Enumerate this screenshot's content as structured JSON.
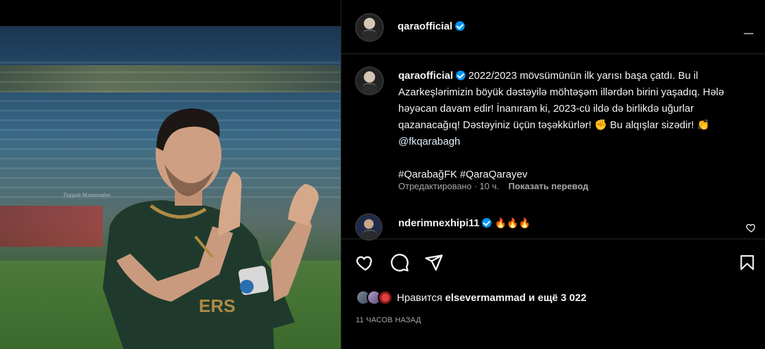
{
  "post": {
    "username": "qaraofficial",
    "caption": "2022/2023 mövsümünün ilk yarısı başa çatdı. Bu il Azarkeşlərimizin böyük dəstəyilə möhtəşəm illərdən birini yaşadıq. Hələ həyəcan davam edir! İnanıram ki, 2023-cü ildə də birlikdə uğurlar qazanacağıq! Dəstəyiniz üçün təşəkkürlər! ✊ Bu alqışlar sizədir! 👏",
    "caption_mention": "@fkqarabagh",
    "hashtags": "#QarabağFK #QaraQarayev",
    "edited_label": "Отредактировано",
    "edited_sep": " · ",
    "edited_time": "10 ч.",
    "translate_label": "Показать перевод",
    "photo_watermark": "Təyyub Məmmədov"
  },
  "comment": {
    "username": "nderimnexhipi11",
    "text": "🔥🔥🔥"
  },
  "actions": {
    "like_icon": "heart-icon",
    "comment_icon": "comment-icon",
    "share_icon": "share-icon",
    "save_icon": "bookmark-icon"
  },
  "likes": {
    "prefix": "Нравится ",
    "user": "elsevermammad",
    "suffix": " и ещё 3 022"
  },
  "timestamp": "11 ЧАСОВ НАЗАД",
  "colors": {
    "background": "#000000",
    "text": "#f5f5f5",
    "secondary": "#a8a8a8",
    "verified": "#0095f6",
    "divider": "#262626"
  }
}
